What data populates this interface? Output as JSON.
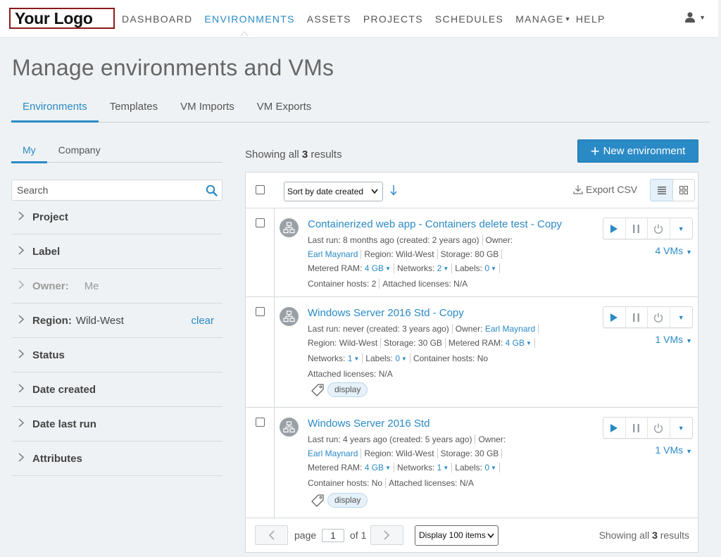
{
  "brand": {
    "logo_text": "Your Logo"
  },
  "nav": {
    "items": [
      {
        "label": "DASHBOARD"
      },
      {
        "label": "ENVIRONMENTS"
      },
      {
        "label": "ASSETS"
      },
      {
        "label": "PROJECTS"
      },
      {
        "label": "SCHEDULES"
      },
      {
        "label": "MANAGE"
      },
      {
        "label": "HELP"
      }
    ],
    "active": "ENVIRONMENTS"
  },
  "page": {
    "title": "Manage environments and VMs"
  },
  "tabs": [
    {
      "label": "Environments"
    },
    {
      "label": "Templates"
    },
    {
      "label": "VM Imports"
    },
    {
      "label": "VM Exports"
    }
  ],
  "sidebar": {
    "scope_tabs": [
      {
        "label": "My"
      },
      {
        "label": "Company"
      }
    ],
    "search_placeholder": "Search",
    "filters": [
      {
        "label": "Project",
        "value": ""
      },
      {
        "label": "Label",
        "value": ""
      },
      {
        "label": "Owner:",
        "value": "Me"
      },
      {
        "label": "Region:",
        "value": "Wild-West",
        "clear": "clear"
      },
      {
        "label": "Status",
        "value": ""
      },
      {
        "label": "Date created",
        "value": ""
      },
      {
        "label": "Date last run",
        "value": ""
      },
      {
        "label": "Attributes",
        "value": ""
      }
    ]
  },
  "main": {
    "results_prefix": "Showing all",
    "results_count": "3",
    "results_suffix": "results",
    "new_env_label": "New environment",
    "sort_label": "Sort by date created",
    "export_label": "Export CSV"
  },
  "environments": [
    {
      "name": "Containerized web app - Containers delete test - Copy",
      "last_run_label": "Last run:",
      "last_run": "8 months ago (created: 2 years ago)",
      "owner_label": "Owner:",
      "owner": "Earl Maynard",
      "region_label": "Region:",
      "region": "Wild-West",
      "storage_label": "Storage:",
      "storage": "80 GB",
      "ram_label": "Metered RAM:",
      "ram": "4 GB",
      "networks_label": "Networks:",
      "networks": "2",
      "labels_label": "Labels:",
      "labels": "0",
      "hosts_label": "Container hosts:",
      "hosts": "2",
      "licenses_label": "Attached licenses:",
      "licenses": "N/A",
      "vms": "4 VMs"
    },
    {
      "name": "Windows Server 2016 Std - Copy",
      "last_run_label": "Last run:",
      "last_run": "never (created: 3 years ago)",
      "owner_label": "Owner:",
      "owner": "Earl Maynard",
      "region_label": "Region:",
      "region": "Wild-West",
      "storage_label": "Storage:",
      "storage": "30 GB",
      "ram_label": "Metered RAM:",
      "ram": "4 GB",
      "networks_label": "Networks:",
      "networks": "1",
      "labels_label": "Labels:",
      "labels": "0",
      "hosts_label": "Container hosts:",
      "hosts": "No",
      "licenses_label": "Attached licenses:",
      "licenses": "N/A",
      "tag": "display",
      "vms": "1 VMs"
    },
    {
      "name": "Windows Server 2016 Std",
      "last_run_label": "Last run:",
      "last_run": "4 years ago (created: 5 years ago)",
      "owner_label": "Owner:",
      "owner": "Earl Maynard",
      "region_label": "Region:",
      "region": "Wild-West",
      "storage_label": "Storage:",
      "storage": "30 GB",
      "ram_label": "Metered RAM:",
      "ram": "4 GB",
      "networks_label": "Networks:",
      "networks": "1",
      "labels_label": "Labels:",
      "labels": "0",
      "hosts_label": "Container hosts:",
      "hosts": "No",
      "licenses_label": "Attached licenses:",
      "licenses": "N/A",
      "tag": "display",
      "vms": "1 VMs"
    }
  ],
  "pager": {
    "page_label": "page",
    "page_value": "1",
    "of_label": "of 1",
    "display_label": "Display 100 items",
    "summary_prefix": "Showing all",
    "summary_count": "3",
    "summary_suffix": "results"
  },
  "colors": {
    "accent": "#2a8ac6",
    "logo_border": "#8b1a1a",
    "background": "#eff2f4"
  },
  "icons": [
    "user-icon",
    "search-icon",
    "chevron-right-icon",
    "plus-icon",
    "sort-down-icon",
    "download-icon",
    "list-view-icon",
    "grid-view-icon",
    "network-icon",
    "play-icon",
    "pause-icon",
    "power-icon",
    "caret-down-icon",
    "tag-icon",
    "chevron-left-icon"
  ]
}
